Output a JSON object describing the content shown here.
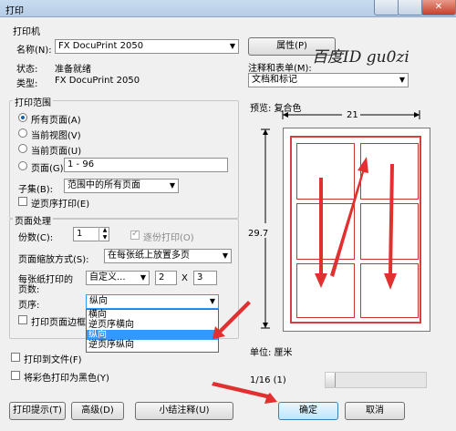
{
  "window": {
    "title": "打印"
  },
  "printer_group": {
    "title": "打印机",
    "name_label": "名称(N):",
    "name_value": "FX DocuPrint 2050",
    "status_label": "状态:",
    "status_value": "准备就绪",
    "type_label": "类型:",
    "type_value": "FX DocuPrint 2050",
    "properties_button": "属性(P)",
    "comments_label": "注释和表单(M):",
    "comments_value": "文档和标记",
    "watermark": "百度ID gu0zi"
  },
  "range_group": {
    "title": "打印范围",
    "options": [
      "所有页面(A)",
      "当前视图(V)",
      "当前页面(U)",
      "页面(G)"
    ],
    "selected_index": 0,
    "pages_value": "1 - 96",
    "subset_label": "子集(B):",
    "subset_value": "范围中的所有页面",
    "reverse_label": "逆页序打印(E)"
  },
  "handling_group": {
    "title": "页面处理",
    "copies_label": "份数(C):",
    "copies_value": "1",
    "collate_label": "逐份打印(O)",
    "scaling_label": "页面缩放方式(S):",
    "scaling_value": "在每张纸上放置多页",
    "pages_per_sheet_label_1": "每张纸打印的",
    "pages_per_sheet_label_2": "页数:",
    "pages_per_sheet_value": "自定义...",
    "pages_x": "2",
    "x_sep": "X",
    "pages_y": "3",
    "order_label": "页序:",
    "order_value": "纵向",
    "order_options": [
      "横向",
      "逆页序横向",
      "纵向",
      "逆页序纵向"
    ],
    "order_selected_index": 2,
    "border_label": "打印页面边框"
  },
  "bottom_options": {
    "print_to_file": "打印到文件(F)",
    "grayscale": "将彩色打印为黑色(Y)"
  },
  "preview": {
    "label": "预览: 复合色",
    "width": "21",
    "height": "29.7",
    "unit_label": "单位: 厘米",
    "page_indicator": "1/16 (1)"
  },
  "buttons": {
    "tips": "打印提示(T)",
    "advanced": "高级(D)",
    "summarize": "小结注释(U)",
    "ok": "确定",
    "cancel": "取消"
  },
  "colors": {
    "accent": "#3399ff",
    "annotation_red": "#e03030"
  }
}
